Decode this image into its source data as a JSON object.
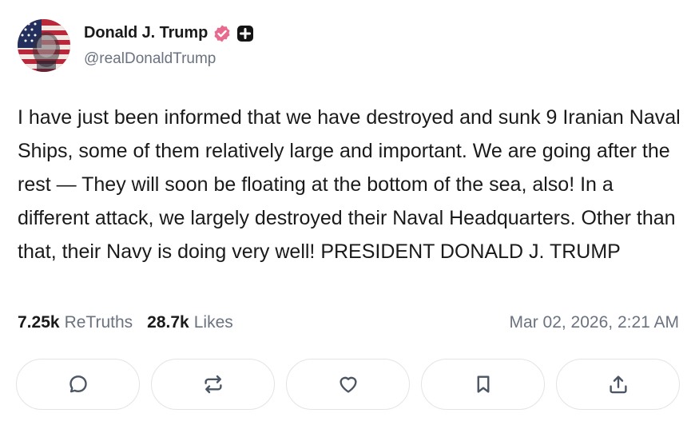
{
  "author": {
    "display_name": "Donald J. Trump",
    "handle": "@realDonaldTrump",
    "verified_color": "#e86b8f",
    "avatar_icon": "flag-portrait-avatar"
  },
  "post": {
    "text": "I have just been informed that we have destroyed and sunk 9 Iranian Naval Ships, some of them relatively large and important. We are going after the rest — They will soon be floating at the bottom of the sea, also! In a different attack, we largely destroyed their Naval Headquarters. Other than that, their Navy is doing very well! PRESIDENT DONALD J. TRUMP",
    "retruths_count": "7.25k",
    "retruths_label": "ReTruths",
    "likes_count": "28.7k",
    "likes_label": "Likes",
    "timestamp": "Mar 02, 2026, 2:21 AM"
  },
  "actions": [
    {
      "name": "reply",
      "icon": "comment-icon"
    },
    {
      "name": "retruth",
      "icon": "repost-icon"
    },
    {
      "name": "like",
      "icon": "heart-icon"
    },
    {
      "name": "bookmark",
      "icon": "bookmark-icon"
    },
    {
      "name": "share",
      "icon": "share-icon"
    }
  ]
}
